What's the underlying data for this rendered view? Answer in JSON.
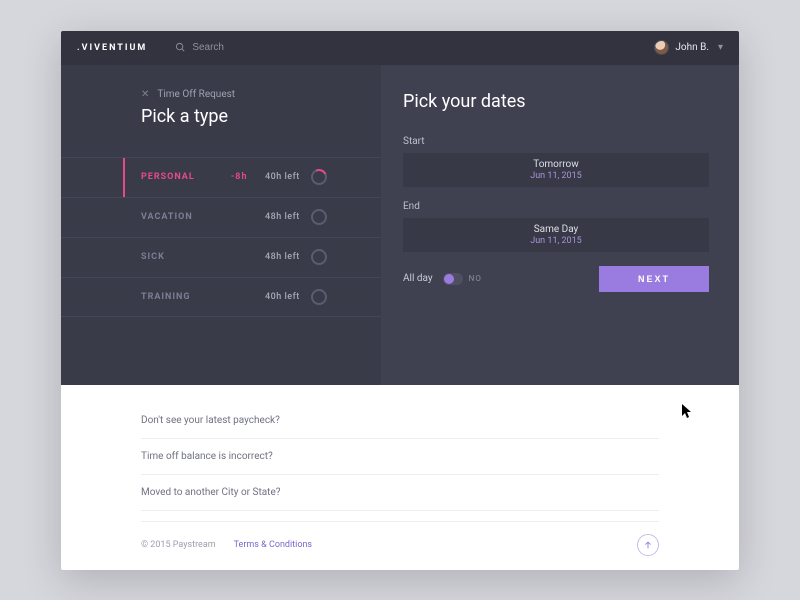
{
  "brand": ".VIVENTIUM",
  "search": {
    "placeholder": "Search"
  },
  "user": {
    "name": "John B."
  },
  "left": {
    "close_label": "Time Off Request",
    "title": "Pick a type",
    "types": [
      {
        "label": "PERSONAL",
        "delta": "-8h",
        "left": "40h left",
        "active": true
      },
      {
        "label": "VACATION",
        "delta": "",
        "left": "48h left",
        "active": false
      },
      {
        "label": "SICK",
        "delta": "",
        "left": "48h left",
        "active": false
      },
      {
        "label": "TRAINING",
        "delta": "",
        "left": "40h left",
        "active": false
      }
    ]
  },
  "right": {
    "title": "Pick your dates",
    "start_label": "Start",
    "start_main": "Tomorrow",
    "start_sub": "Jun 11, 2015",
    "end_label": "End",
    "end_main": "Same Day",
    "end_sub": "Jun 11, 2015",
    "allday_label": "All day",
    "allday_value": "NO",
    "next": "NEXT"
  },
  "faq": [
    "Don't see your latest paycheck?",
    "Time off balance is incorrect?",
    "Moved to another City or State?"
  ],
  "footer": {
    "copyright": "© 2015 Paystream",
    "terms": "Terms & Conditions"
  }
}
